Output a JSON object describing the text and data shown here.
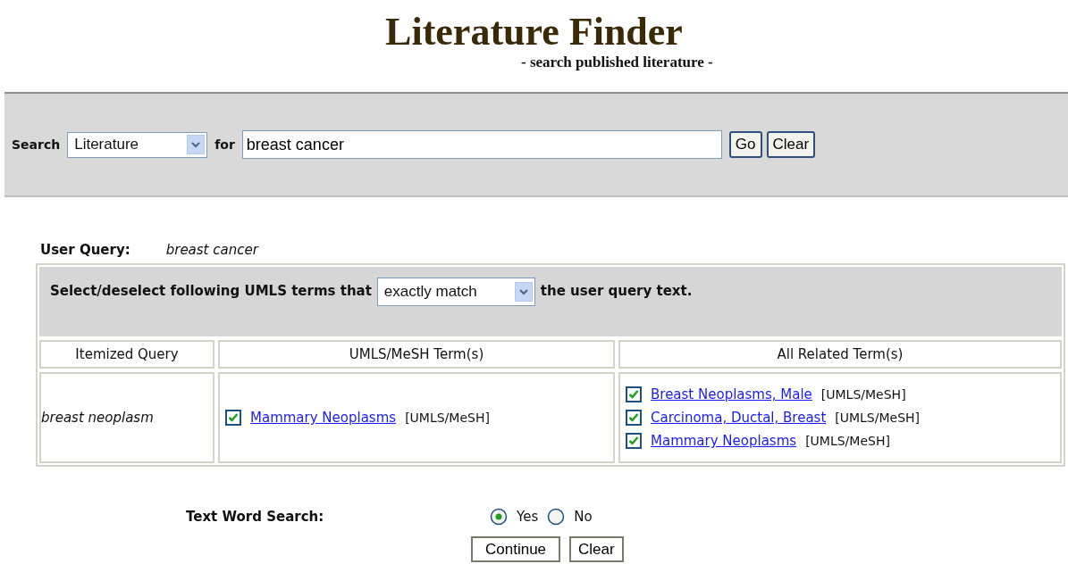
{
  "header": {
    "title": "Literature Finder",
    "subtitle": "- search published literature -"
  },
  "search_bar": {
    "label": "Search",
    "source": "Literature",
    "for_label": "for",
    "query": "breast cancer",
    "buttons": [
      "Go",
      "Clear"
    ]
  },
  "user_query": {
    "label": "User Query:",
    "value": "breast cancer"
  },
  "terms_panel": {
    "intro": "Select/deselect following UMLS terms that",
    "match_mode": "exactly match",
    "outro": "the user query text.",
    "columns": [
      "Itemized Query",
      "UMLS/MeSH Term(s)",
      "All Related Term(s)"
    ],
    "rows": [
      {
        "query": "breast neoplasm",
        "terms": [
          {
            "term": "Mammary Neoplasms",
            "source": "[UMLS/MeSH]",
            "checked": true
          }
        ],
        "related": [
          {
            "term": "Breast Neoplasms, Male",
            "source": "[UMLS/MeSH]",
            "checked": true
          },
          {
            "term": "Carcinoma, Ductal, Breast",
            "source": "[UMLS/MeSH]",
            "checked": true
          },
          {
            "term": "Mammary Neoplasms",
            "source": "[UMLS/MeSH]",
            "checked": true
          }
        ]
      }
    ]
  },
  "text_word_search": {
    "label": "Text Word Search:",
    "options": [
      {
        "label": "Yes",
        "selected": true
      },
      {
        "label": "No",
        "selected": false
      }
    ]
  },
  "buttons": [
    "Continue",
    "Clear"
  ]
}
